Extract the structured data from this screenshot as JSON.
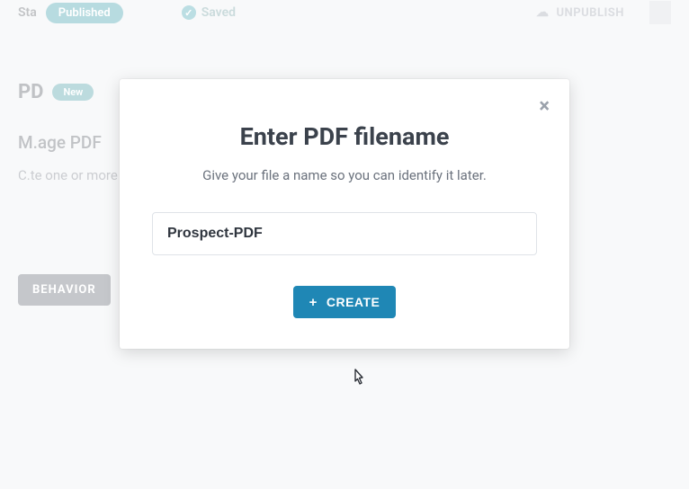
{
  "topbar": {
    "sta_label": "Sta",
    "published_pill": "Published",
    "saved_label": "Saved",
    "unpublish_label": "UNPUBLISH"
  },
  "card": {
    "pd_label": "PD",
    "new_pill": "New",
    "title": "M.age PDF",
    "desc": "C.te one or more templates that autopopulated for submission. When you do, you'll be",
    "behavior_btn": "BEHAVIOR"
  },
  "modal": {
    "title": "Enter PDF filename",
    "subtitle": "Give your file a name so you can identify it later.",
    "input_value": "Prospect-PDF",
    "create_label": "CREATE",
    "close_glyph": "×"
  }
}
